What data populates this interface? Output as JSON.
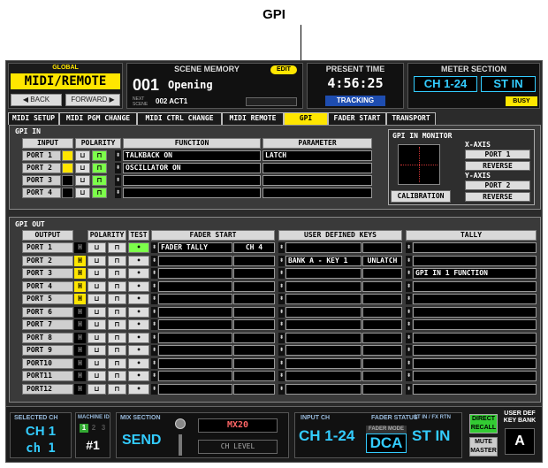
{
  "callout": "GPI",
  "global_label": "GLOBAL",
  "app_title": "MIDI/REMOTE",
  "back_label": "◀ BACK",
  "forward_label": "FORWARD ▶",
  "scene_memory": {
    "label": "SCENE MEMORY",
    "edit": "EDIT",
    "number": "001",
    "name": "Opening",
    "next_label": "NEXT SCENE",
    "next_scene": "002 ACT1"
  },
  "present_time": {
    "label": "PRESENT TIME",
    "time": "4:56:25",
    "tracking": "TRACKING"
  },
  "meter_section": {
    "label": "METER SECTION",
    "ch": "CH 1-24",
    "st": "ST IN",
    "busy": "BUSY"
  },
  "tabs": [
    "MIDI SETUP",
    "MIDI PGM CHANGE",
    "MIDI CTRL CHANGE",
    "MIDI REMOTE",
    "GPI",
    "FADER START",
    "TRANSPORT"
  ],
  "active_tab": "GPI",
  "gpi_in": {
    "title": "GPI IN",
    "headers": {
      "input": "INPUT",
      "polarity": "POLARITY",
      "function": "FUNCTION",
      "parameter": "PARAMETER"
    },
    "rows": [
      {
        "port": "PORT 1",
        "function": "TALKBACK ON",
        "parameter": "LATCH",
        "active": true
      },
      {
        "port": "PORT 2",
        "function": "OSCILLATOR ON",
        "parameter": "",
        "active": true
      },
      {
        "port": "PORT 3",
        "function": "",
        "parameter": "",
        "active": false
      },
      {
        "port": "PORT 4",
        "function": "",
        "parameter": "",
        "active": false
      }
    ]
  },
  "gpi_monitor": {
    "title": "GPI IN MONITOR",
    "x_axis": "X-AXIS",
    "x_port": "PORT 1",
    "x_reverse": "REVERSE",
    "y_axis": "Y-AXIS",
    "y_port": "PORT 2",
    "y_reverse": "REVERSE",
    "calibration": "CALIBRATION"
  },
  "gpi_out": {
    "title": "GPI OUT",
    "headers": {
      "output": "OUTPUT",
      "polarity": "POLARITY",
      "test": "TEST",
      "fader_start": "FADER START",
      "user_keys": "USER DEFINED KEYS",
      "tally": "TALLY"
    },
    "rows": [
      {
        "port": "PORT 1",
        "h": "H",
        "hon": false,
        "fader": "FADER TALLY",
        "ch": "CH 4",
        "key": "",
        "latch": "",
        "tally": ""
      },
      {
        "port": "PORT 2",
        "h": "H",
        "hon": true,
        "fader": "",
        "ch": "",
        "key": "BANK A - KEY 1",
        "latch": "UNLATCH",
        "tally": ""
      },
      {
        "port": "PORT 3",
        "h": "H",
        "hon": true,
        "fader": "",
        "ch": "",
        "key": "",
        "latch": "",
        "tally": "GPI IN 1 FUNCTION"
      },
      {
        "port": "PORT 4",
        "h": "H",
        "hon": true,
        "fader": "",
        "ch": "",
        "key": "",
        "latch": "",
        "tally": ""
      },
      {
        "port": "PORT 5",
        "h": "H",
        "hon": true,
        "fader": "",
        "ch": "",
        "key": "",
        "latch": "",
        "tally": ""
      },
      {
        "port": "PORT 6",
        "h": "H",
        "hon": false,
        "fader": "",
        "ch": "",
        "key": "",
        "latch": "",
        "tally": ""
      },
      {
        "port": "PORT 7",
        "h": "H",
        "hon": false,
        "fader": "",
        "ch": "",
        "key": "",
        "latch": "",
        "tally": ""
      },
      {
        "port": "PORT 8",
        "h": "H",
        "hon": false,
        "fader": "",
        "ch": "",
        "key": "",
        "latch": "",
        "tally": ""
      },
      {
        "port": "PORT 9",
        "h": "H",
        "hon": false,
        "fader": "",
        "ch": "",
        "key": "",
        "latch": "",
        "tally": ""
      },
      {
        "port": "PORT10",
        "h": "H",
        "hon": false,
        "fader": "",
        "ch": "",
        "key": "",
        "latch": "",
        "tally": ""
      },
      {
        "port": "PORT11",
        "h": "H",
        "hon": false,
        "fader": "",
        "ch": "",
        "key": "",
        "latch": "",
        "tally": ""
      },
      {
        "port": "PORT12",
        "h": "H",
        "hon": false,
        "fader": "",
        "ch": "",
        "key": "",
        "latch": "",
        "tally": ""
      }
    ]
  },
  "footer": {
    "selected_ch_label": "SELECTED CH",
    "selected_ch": "CH 1",
    "selected_ch_name": "ch 1",
    "machine_id_label": "MACHINE ID",
    "machine_id": "#1",
    "machine_nums": [
      "1",
      "2",
      "3"
    ],
    "mix_section_label": "MIX SECTION",
    "mix_send": "SEND",
    "mix_bus": "MX20",
    "ch_level": "CH LEVEL",
    "input_ch_label": "INPUT CH",
    "input_ch": "CH 1-24",
    "fader_status_label": "FADER STATUS",
    "fader_mode": "FADER MODE",
    "fader_dca": "DCA",
    "st_label": "ST IN / FX RTN",
    "st_in": "ST IN",
    "direct_recall": "DIRECT RECALL",
    "mute_master": "MUTE MASTER",
    "user_def_label": "USER DEF KEY BANK",
    "user_def_bank": "A"
  },
  "colors": {
    "active_tab": "#ffe600",
    "polarity_on": "#7cff4a",
    "port_active": "#ffe600",
    "h_on": "#ffe600",
    "accent": "#33ccff"
  }
}
